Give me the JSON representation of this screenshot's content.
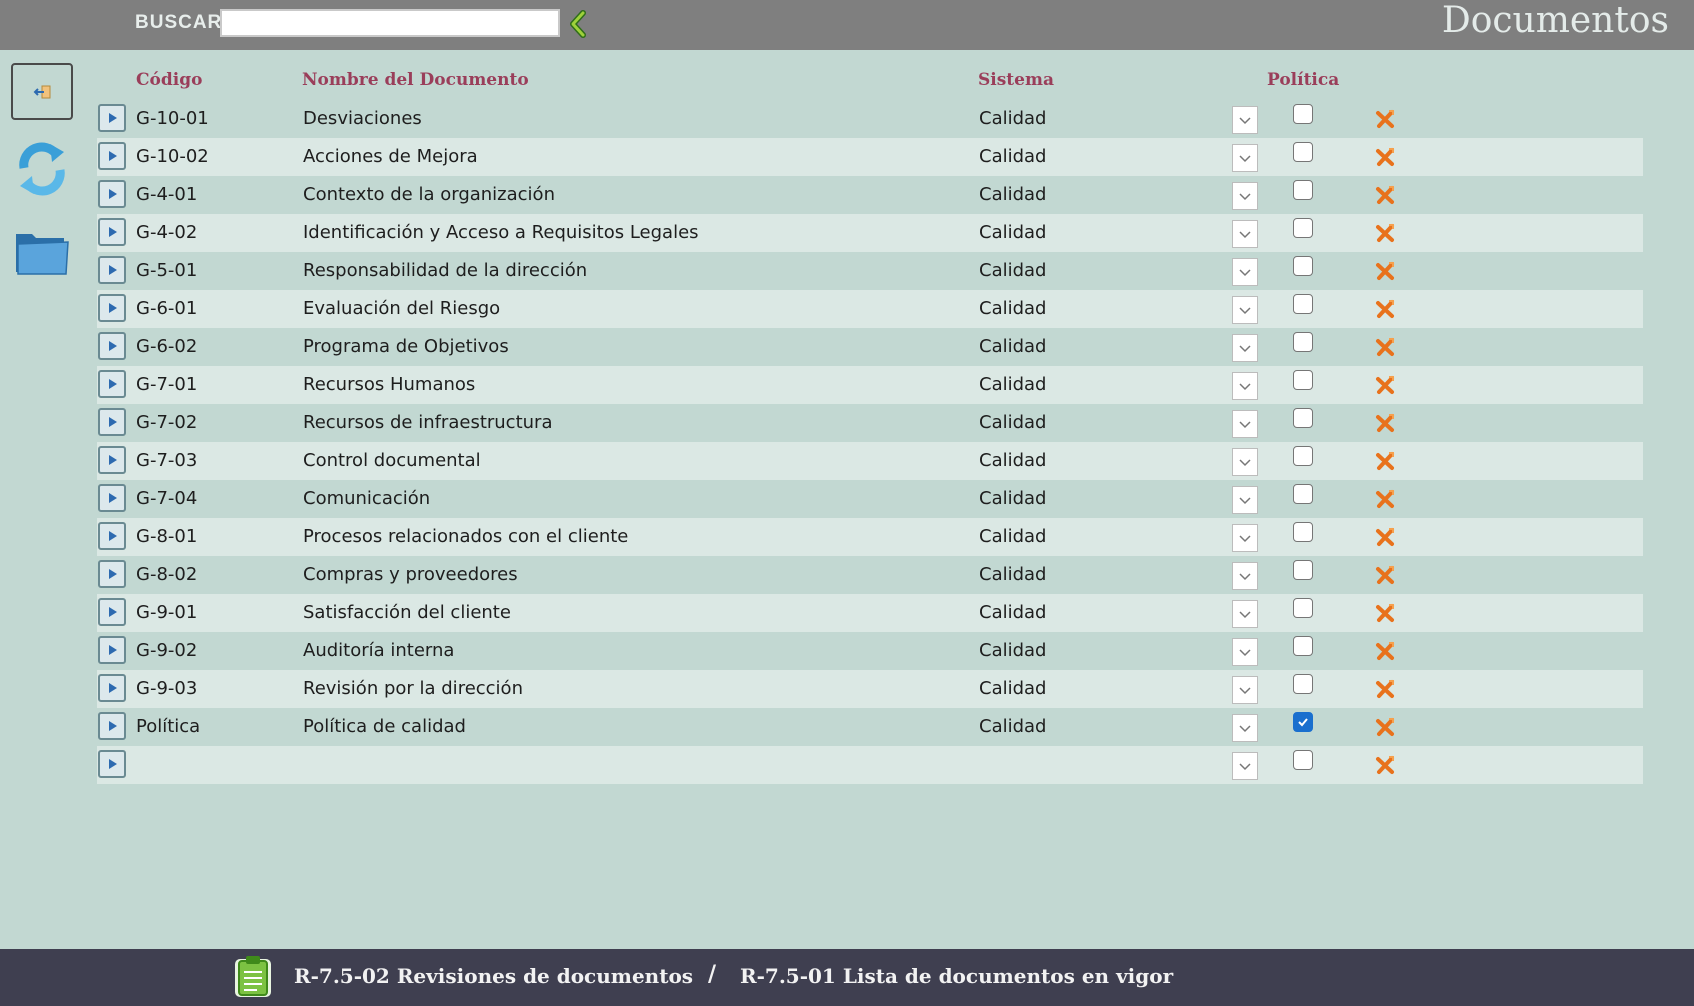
{
  "header": {
    "search_label": "BUSCAR",
    "search_value": "",
    "page_title": "Documentos",
    "search_go_icon": "chevron-left-icon"
  },
  "sidebar": {
    "back_icon": "exit-icon",
    "refresh_icon": "refresh-icon",
    "folder_icon": "folder-icon"
  },
  "table": {
    "columns": {
      "code": "Código",
      "name": "Nombre del Documento",
      "system": "Sistema",
      "policy": "Política"
    },
    "rows": [
      {
        "code": "G-10-01",
        "name": "Desviaciones",
        "system": "Calidad",
        "policy": false
      },
      {
        "code": "G-10-02",
        "name": "Acciones de Mejora",
        "system": "Calidad",
        "policy": false
      },
      {
        "code": "G-4-01",
        "name": "Contexto de la organización",
        "system": "Calidad",
        "policy": false
      },
      {
        "code": "G-4-02",
        "name": "Identificación y Acceso a Requisitos Legales",
        "system": "Calidad",
        "policy": false
      },
      {
        "code": "G-5-01",
        "name": "Responsabilidad de la dirección",
        "system": "Calidad",
        "policy": false
      },
      {
        "code": "G-6-01",
        "name": "Evaluación del Riesgo",
        "system": "Calidad",
        "policy": false
      },
      {
        "code": "G-6-02",
        "name": "Programa de Objetivos",
        "system": "Calidad",
        "policy": false
      },
      {
        "code": "G-7-01",
        "name": "Recursos Humanos",
        "system": "Calidad",
        "policy": false
      },
      {
        "code": "G-7-02",
        "name": "Recursos de infraestructura",
        "system": "Calidad",
        "policy": false
      },
      {
        "code": "G-7-03",
        "name": "Control documental",
        "system": "Calidad",
        "policy": false
      },
      {
        "code": "G-7-04",
        "name": "Comunicación",
        "system": "Calidad",
        "policy": false
      },
      {
        "code": "G-8-01",
        "name": "Procesos relacionados con el cliente",
        "system": "Calidad",
        "policy": false
      },
      {
        "code": "G-8-02",
        "name": "Compras y proveedores",
        "system": "Calidad",
        "policy": false
      },
      {
        "code": "G-9-01",
        "name": "Satisfacción del cliente",
        "system": "Calidad",
        "policy": false
      },
      {
        "code": "G-9-02",
        "name": "Auditoría interna",
        "system": "Calidad",
        "policy": false
      },
      {
        "code": "G-9-03",
        "name": "Revisión por la dirección",
        "system": "Calidad",
        "policy": false
      },
      {
        "code": "Política",
        "name": "Política de calidad",
        "system": "Calidad",
        "policy": true
      },
      {
        "code": "",
        "name": "",
        "system": "",
        "policy": false
      }
    ]
  },
  "footer": {
    "link1": "R-7.5-02 Revisiones de documentos",
    "separator": "/",
    "link2": "R-7.5-01 Lista de documentos en vigor",
    "icon": "clipboard-icon"
  },
  "colors": {
    "background": "#c2d8d2",
    "header_bar": "#7f7f7f",
    "footer_bar": "#3f3f50",
    "column_header": "#9a3e5a",
    "delete_icon": "#e8721c",
    "checkbox_checked": "#1a6fce"
  }
}
